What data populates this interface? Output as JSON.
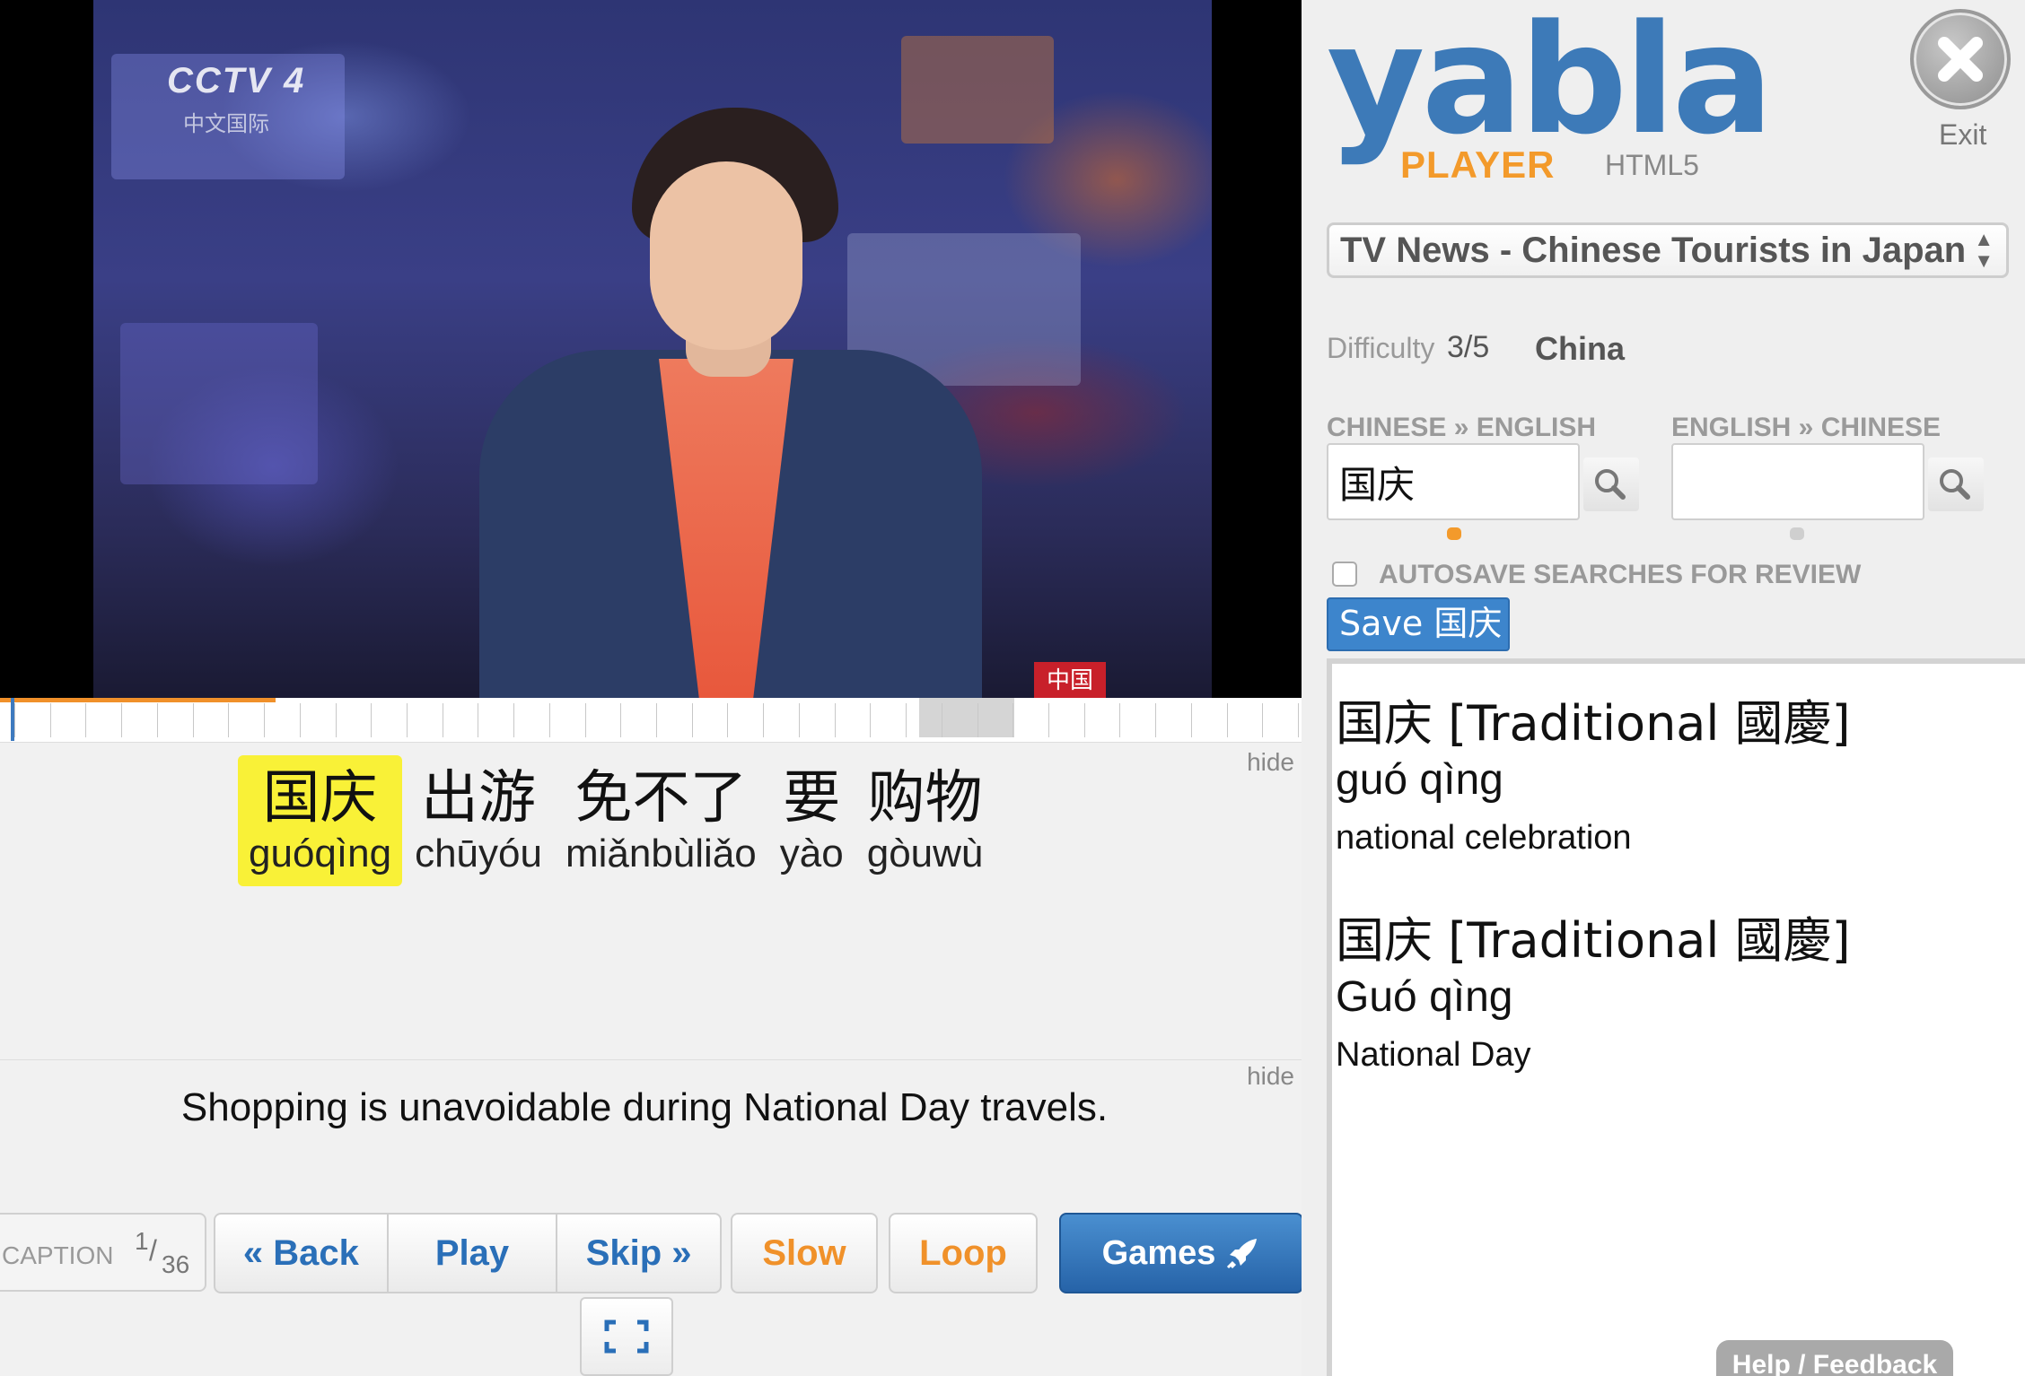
{
  "video": {
    "channel_logo": "CCTV 4",
    "channel_subtitle": "中文国际",
    "corner_bug": "中国"
  },
  "timeline": {
    "played_fraction": 0.212,
    "segment_count": 36,
    "current_segment": 1
  },
  "caption": {
    "hide_label": "hide",
    "words": [
      {
        "hanzi": "国庆",
        "pinyin": "guóqìng",
        "active": true
      },
      {
        "hanzi": "出游",
        "pinyin": "chūyóu",
        "active": false
      },
      {
        "hanzi": "免不了",
        "pinyin": "miǎnbùliǎo",
        "active": false
      },
      {
        "hanzi": "要",
        "pinyin": "yào",
        "active": false
      },
      {
        "hanzi": "购物",
        "pinyin": "gòuwù",
        "active": false
      }
    ]
  },
  "translation": {
    "hide_label": "hide",
    "text": "Shopping is unavoidable during National Day travels."
  },
  "controls": {
    "caption_label": "CAPTION",
    "caption_current": "1",
    "caption_total": "36",
    "back_label": "« Back",
    "play_label": "Play",
    "skip_label": "Skip »",
    "slow_label": "Slow",
    "loop_label": "Loop",
    "games_label": "Games",
    "games_icon": "rocket-icon",
    "fullscreen_icon": "fullscreen-icon"
  },
  "sidebar": {
    "logo_text": "yabla",
    "logo_player": "PLAYER",
    "logo_html5": "HTML5",
    "exit_label": "Exit",
    "video_title": "TV News - Chinese Tourists in Japan",
    "difficulty_label": "Difficulty",
    "difficulty_value": "3/5",
    "country": "China",
    "dict_cn_en_label": "CHINESE » ENGLISH",
    "dict_en_cn_label": "ENGLISH » CHINESE",
    "dict_cn_en_value": "国庆",
    "dict_en_cn_value": "",
    "autosave_label": "AUTOSAVE SEARCHES FOR REVIEW",
    "autosave_checked": false,
    "save_button_label": "Save 国庆",
    "help_label": "Help / Feedback",
    "colors": {
      "brand_blue": "#3d7ab8",
      "brand_orange": "#f39a2b",
      "highlight_yellow": "#f9f137"
    }
  },
  "definitions": [
    {
      "headword": "国庆 [Traditional 國慶]",
      "pinyin": "guó qìng",
      "meaning": "national celebration"
    },
    {
      "headword": "国庆 [Traditional 國慶]",
      "pinyin": "Guó qìng",
      "meaning": "National Day"
    }
  ]
}
